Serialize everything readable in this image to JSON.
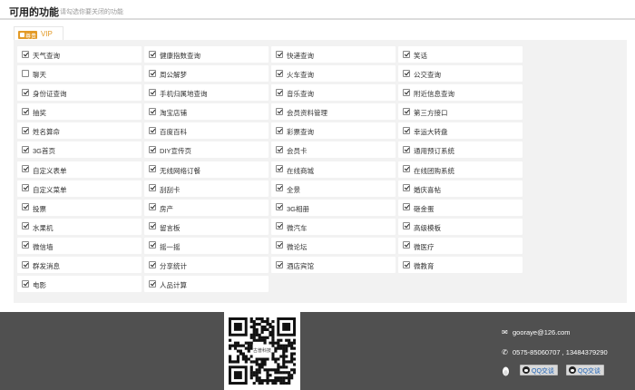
{
  "header": {
    "title": "可用的功能",
    "subtitle": "请勾选你要关闭的功能"
  },
  "tab": {
    "badge_text": "尊贵",
    "label": "VIP"
  },
  "features": [
    {
      "label": "天气查询",
      "checked": true
    },
    {
      "label": "健康指数查询",
      "checked": true
    },
    {
      "label": "快递查询",
      "checked": true
    },
    {
      "label": "笑话",
      "checked": true
    },
    {
      "label": "聊天",
      "checked": false
    },
    {
      "label": "周公解梦",
      "checked": true
    },
    {
      "label": "火车查询",
      "checked": true
    },
    {
      "label": "公交查询",
      "checked": true
    },
    {
      "label": "身份证查询",
      "checked": true
    },
    {
      "label": "手机归属地查询",
      "checked": true
    },
    {
      "label": "音乐查询",
      "checked": true
    },
    {
      "label": "附近信息查询",
      "checked": true
    },
    {
      "label": "抽奖",
      "checked": true
    },
    {
      "label": "淘宝店铺",
      "checked": true
    },
    {
      "label": "会员资料管理",
      "checked": true
    },
    {
      "label": "第三方接口",
      "checked": true
    },
    {
      "label": "姓名算命",
      "checked": true
    },
    {
      "label": "百度百科",
      "checked": true
    },
    {
      "label": "彩票查询",
      "checked": true
    },
    {
      "label": "幸运大转盘",
      "checked": true
    },
    {
      "label": "3G首页",
      "checked": true
    },
    {
      "label": "DIY宣传页",
      "checked": true
    },
    {
      "label": "会员卡",
      "checked": true
    },
    {
      "label": "通用预订系统",
      "checked": true
    },
    {
      "label": "自定义表单",
      "checked": true
    },
    {
      "label": "无线网络订餐",
      "checked": true
    },
    {
      "label": "在线商城",
      "checked": true
    },
    {
      "label": "在线团购系统",
      "checked": true
    },
    {
      "label": "自定义菜单",
      "checked": true
    },
    {
      "label": "刮刮卡",
      "checked": true
    },
    {
      "label": "全景",
      "checked": true
    },
    {
      "label": "婚庆喜帖",
      "checked": true
    },
    {
      "label": "投票",
      "checked": true
    },
    {
      "label": "房产",
      "checked": true
    },
    {
      "label": "3G相册",
      "checked": true
    },
    {
      "label": "砸金蛋",
      "checked": true
    },
    {
      "label": "水果机",
      "checked": true
    },
    {
      "label": "留言板",
      "checked": true
    },
    {
      "label": "微汽车",
      "checked": true
    },
    {
      "label": "高级模板",
      "checked": true
    },
    {
      "label": "微信墙",
      "checked": true
    },
    {
      "label": "摇一摇",
      "checked": true
    },
    {
      "label": "微论坛",
      "checked": true
    },
    {
      "label": "微医疗",
      "checked": true
    },
    {
      "label": "群发消息",
      "checked": true
    },
    {
      "label": "分享统计",
      "checked": true
    },
    {
      "label": "酒店宾馆",
      "checked": true
    },
    {
      "label": "微教育",
      "checked": true
    },
    {
      "label": "电影",
      "checked": true
    },
    {
      "label": "人品计算",
      "checked": true
    }
  ],
  "footer": {
    "qr_caption": "古普科技",
    "email": "gooraye@126.com",
    "phone": "0575-85060707 , 13484379290",
    "qq_buttons": [
      "QQ交谈",
      "QQ交谈"
    ],
    "colors": {
      "background": "#505050",
      "accent": "#e39a26"
    }
  }
}
